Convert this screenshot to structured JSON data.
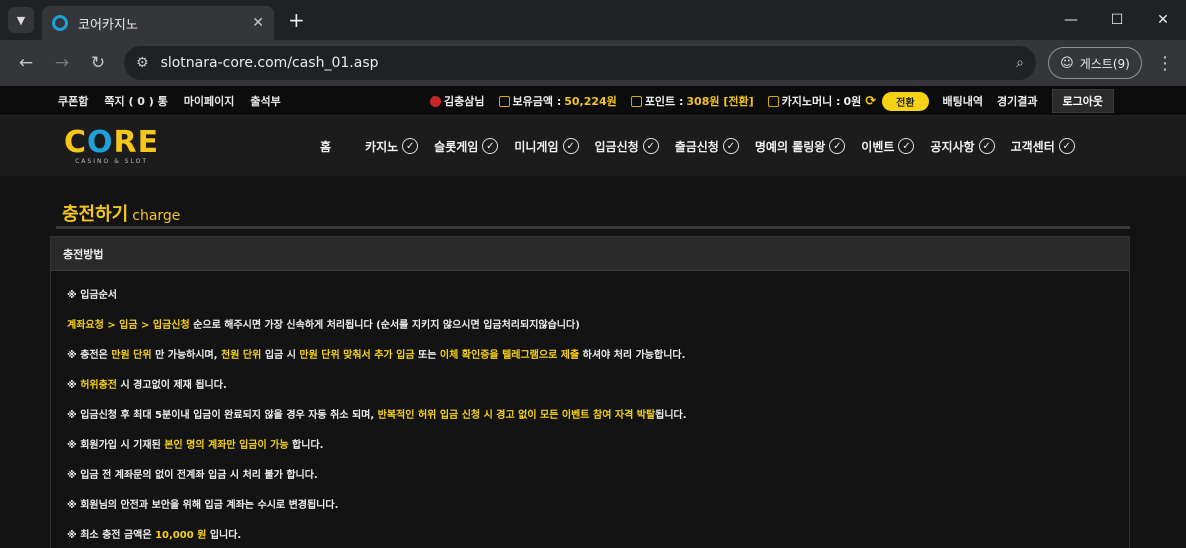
{
  "browser": {
    "tab_title": "코어카지노",
    "url": "slotnara-core.com/cash_01.asp",
    "guest_label": "게스트(9)"
  },
  "topbar": {
    "links": [
      "쿠폰함",
      "쪽지 ( 0 ) 통",
      "마이페이지",
      "출석부"
    ],
    "user": "김충삼님",
    "balance_label": "보유금액 :",
    "balance_value": "50,224원",
    "point_label": "포인트 :",
    "point_value": "308원 [전환]",
    "casino_money_label": "카지노머니 :",
    "casino_money_value": "0원",
    "swap_label": "전환",
    "bet_history": "배팅내역",
    "results": "경기결과",
    "logout": "로그아웃"
  },
  "logo": {
    "main": "CORE",
    "sub": "CASINO & SLOT"
  },
  "nav": {
    "items": [
      {
        "label": "홈",
        "check": false
      },
      {
        "label": "카지노",
        "check": true
      },
      {
        "label": "슬롯게임",
        "check": true
      },
      {
        "label": "미니게임",
        "check": true
      },
      {
        "label": "입금신청",
        "check": true
      },
      {
        "label": "출금신청",
        "check": true
      },
      {
        "label": "명예의 롤링왕",
        "check": true
      },
      {
        "label": "이벤트",
        "check": true
      },
      {
        "label": "공지사항",
        "check": true
      },
      {
        "label": "고객센터",
        "check": true
      }
    ]
  },
  "page": {
    "title_ko": "충전하기",
    "title_en": "charge",
    "panel_title": "충전방법",
    "rows": [
      [
        {
          "t": "※ 입금순서",
          "hl": false
        }
      ],
      [
        {
          "t": "계좌요청 > 입금 > 입금신청",
          "hl": true
        },
        {
          "t": " 순으로 해주시면 가장 신속하게 처리됩니다 (순서를 지키지 않으시면 입금처리되지않습니다)",
          "hl": false
        }
      ],
      [
        {
          "t": "※ 충전은 ",
          "hl": false
        },
        {
          "t": "만원 단위",
          "hl": true
        },
        {
          "t": " 만 가능하시며, ",
          "hl": false
        },
        {
          "t": "천원 단위",
          "hl": true
        },
        {
          "t": " 입금 시 ",
          "hl": false
        },
        {
          "t": "만원 단위 맞춰서 추가 입금",
          "hl": true
        },
        {
          "t": " 또는 ",
          "hl": false
        },
        {
          "t": "이체 확인증을 텔레그램으로 제출",
          "hl": true
        },
        {
          "t": " 하셔야 처리 가능합니다.",
          "hl": false
        }
      ],
      [
        {
          "t": "※ ",
          "hl": false
        },
        {
          "t": "허위충전",
          "hl": true
        },
        {
          "t": " 시 경고없이 제재 됩니다.",
          "hl": false
        }
      ],
      [
        {
          "t": "※ 입금신청 후 최대 5분이내 입금이 완료되지 않을 경우 자동 취소 되며, ",
          "hl": false
        },
        {
          "t": "반복적인 허위 입금 신청 시 경고 없이 모든 이벤트 참여 자격 박탈",
          "hl": true
        },
        {
          "t": "됩니다.",
          "hl": false
        }
      ],
      [
        {
          "t": "※ 회원가입 시 기재된 ",
          "hl": false
        },
        {
          "t": "본인 명의 계좌만 입금이 가능",
          "hl": true
        },
        {
          "t": " 합니다.",
          "hl": false
        }
      ],
      [
        {
          "t": "※ 입금 전 계좌문의 없이 전계좌 입금 시 처리 불가 합니다.",
          "hl": false
        }
      ],
      [
        {
          "t": "※ 회원님의 안전과 보안을 위해 입금 계좌는 수시로 변경됩니다.",
          "hl": false
        }
      ],
      [
        {
          "t": "※ 최소 충전 금액은 ",
          "hl": false
        },
        {
          "t": "10,000 원",
          "hl": true
        },
        {
          "t": " 입니다.",
          "hl": false
        }
      ]
    ]
  }
}
